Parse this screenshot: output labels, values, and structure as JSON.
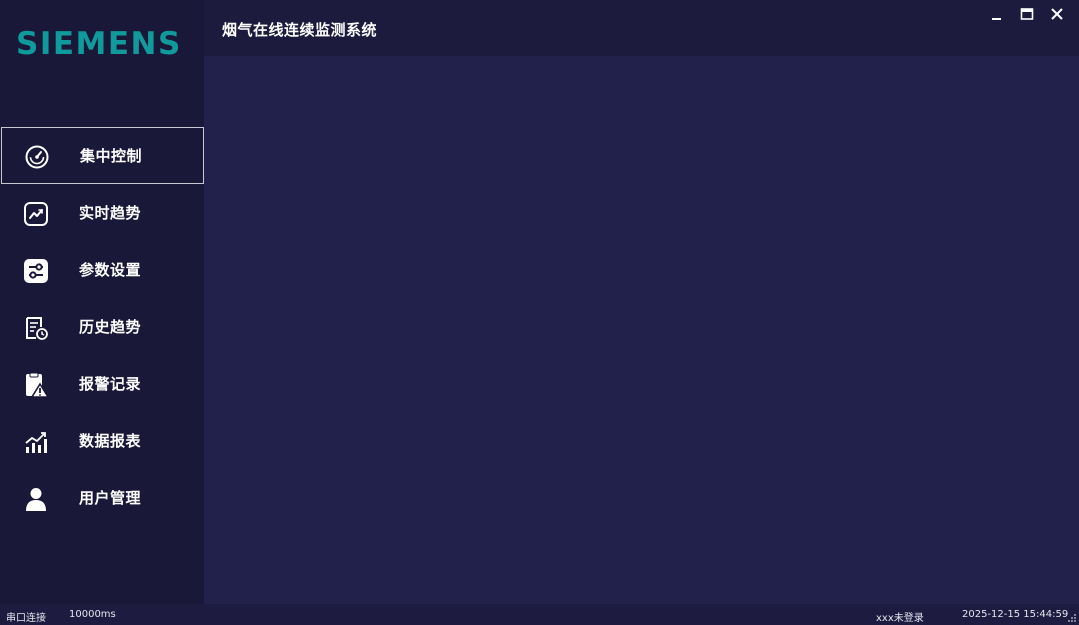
{
  "app": {
    "logo": "SIEMENS",
    "title": "烟气在线连续监测系统",
    "colors": {
      "logo": "#109a9b",
      "sidebar_bg": "#1a1838",
      "content_bg": "#22214b",
      "text": "#ffffff"
    }
  },
  "window_controls": {
    "minimize": "minimize-icon",
    "maximize": "maximize-icon",
    "close": "close-icon"
  },
  "sidebar": {
    "items": [
      {
        "label": "集中控制",
        "icon": "gauge-icon",
        "active": true
      },
      {
        "label": "实时趋势",
        "icon": "trend-chart-icon",
        "active": false
      },
      {
        "label": "参数设置",
        "icon": "sliders-icon",
        "active": false
      },
      {
        "label": "历史趋势",
        "icon": "history-document-icon",
        "active": false
      },
      {
        "label": "报警记录",
        "icon": "alarm-clipboard-icon",
        "active": false
      },
      {
        "label": "数据报表",
        "icon": "bar-chart-icon",
        "active": false
      },
      {
        "label": "用户管理",
        "icon": "user-icon",
        "active": false
      }
    ]
  },
  "status": {
    "port": "串口连接",
    "interval": "10000ms",
    "user": "xxx未登录",
    "datetime": "2025-12-15 15:44:59"
  }
}
